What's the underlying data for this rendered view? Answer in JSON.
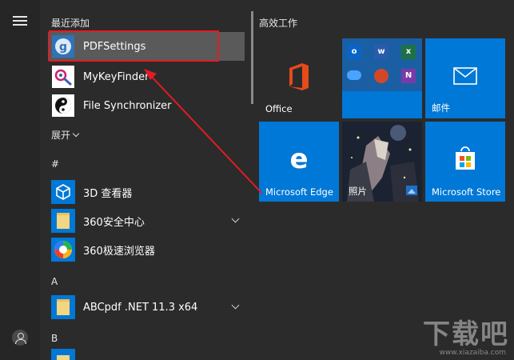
{
  "recent": {
    "title": "最近添加",
    "items": [
      {
        "label": "PDFSettings"
      },
      {
        "label": "MyKeyFinder"
      },
      {
        "label": "File Synchronizer"
      }
    ]
  },
  "expand_label": "展开",
  "sections": [
    {
      "letter": "#",
      "items": [
        {
          "label": "3D 查看器"
        },
        {
          "label": "360安全中心"
        },
        {
          "label": "360极速浏览器"
        }
      ]
    },
    {
      "letter": "A",
      "items": [
        {
          "label": "ABCpdf .NET 11.3 x64"
        }
      ]
    },
    {
      "letter": "B",
      "items": []
    }
  ],
  "tiles": {
    "group_title": "高效工作",
    "office": "Office",
    "mail": "邮件",
    "edge": "Microsoft Edge",
    "photos": "照片",
    "store": "Microsoft Store"
  },
  "watermark": {
    "text": "下载吧",
    "url": "www.xiazaiba.com"
  },
  "colors": {
    "tile_blue": "#0078d7",
    "highlight_red": "#e31c23",
    "background": "#2b2b2b"
  }
}
